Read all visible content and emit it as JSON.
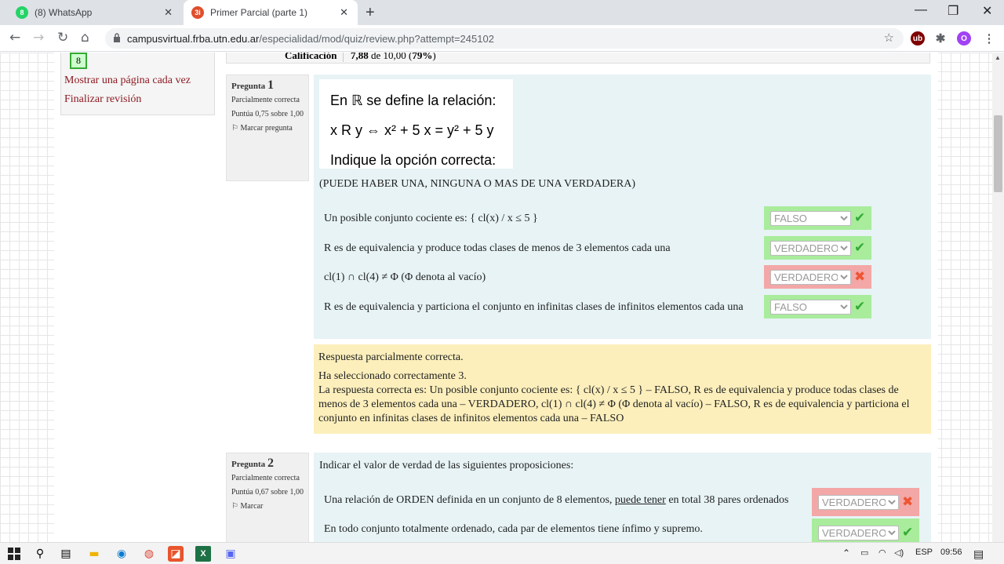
{
  "browser": {
    "tabs": [
      {
        "label": "(8) WhatsApp",
        "favicon": "whatsapp-icon",
        "favicon_text": "8",
        "color": "#25d366"
      },
      {
        "label": "Primer Parcial (parte 1)",
        "favicon": "moodle-icon",
        "favicon_text": "3i",
        "color": "#e04e2b"
      }
    ],
    "url_host": "campusvirtual.frba.utn.edu.ar",
    "url_path": "/especialidad/mod/quiz/review.php?attempt=245102",
    "profile_initial": "O"
  },
  "nav": {
    "current_page": "8",
    "links": [
      "Mostrar una página cada vez",
      "Finalizar revisión"
    ]
  },
  "grade": {
    "label": "Calificación",
    "value": "7,88",
    "rest": " de 10,00 (",
    "percent": "79%",
    "close": ")"
  },
  "q1": {
    "title": "Pregunta",
    "number": "1",
    "state": "Parcialmente correcta",
    "score": "Puntúa 0,75 sobre 1,00",
    "flag": "Marcar pregunta",
    "img_line1": "En ℝ se define la relación:",
    "img_line2": "x R y ⇔ x² + 5 x = y² + 5 y",
    "img_line3": "Indique la opción correcta:",
    "instruction": "(PUEDE HABER UNA, NINGUNA O MAS DE UNA VERDADERA)",
    "items": [
      {
        "text": "Un posible conjunto cociente es:  { cl(x) / x ≤ 5 }",
        "answer": "FALSO",
        "correct": true
      },
      {
        "text": "R es de equivalencia y produce todas clases de menos de 3 elementos cada una",
        "answer": "VERDADERO",
        "correct": true
      },
      {
        "text": "cl(1) ∩ cl(4) ≠ Φ  (Φ denota al vacío)",
        "answer": "VERDADERO",
        "correct": false
      },
      {
        "text": "R es de equivalencia y particiona el conjunto en infinitas clases de infinitos elementos cada una",
        "answer": "FALSO",
        "correct": true
      }
    ],
    "feedback1": "Respuesta parcialmente correcta.",
    "feedback2": "Ha seleccionado correctamente 3.",
    "feedback3": "La respuesta correcta es: Un posible conjunto cociente es:  { cl(x) / x ≤ 5 } – FALSO, R es de equivalencia y produce todas clases de menos de 3 elementos cada una  – VERDADERO, cl(1) ∩ cl(4) ≠ Φ  (Φ denota al vacío) – FALSO, R es de equivalencia y particiona el conjunto en infinitas clases de infinitos elementos cada una – FALSO"
  },
  "q2": {
    "title": "Pregunta",
    "number": "2",
    "state": "Parcialmente correcta",
    "score": "Puntúa 0,67 sobre 1,00",
    "flag": "Marcar",
    "instruction": "Indicar el valor de verdad de las siguientes proposiciones:",
    "item1_pre": "Una relación de ORDEN definida en un conjunto de 8 elementos, ",
    "item1_u": "puede tener",
    "item1_post": " en total 38 pares ordenados",
    "item1_answer": "VERDADERO",
    "item2": "En todo conjunto totalmente ordenado, cada par de elementos tiene ínfimo y supremo.",
    "item2_answer": "VERDADERO"
  },
  "taskbar": {
    "lang": "ESP",
    "time": "09:56"
  }
}
